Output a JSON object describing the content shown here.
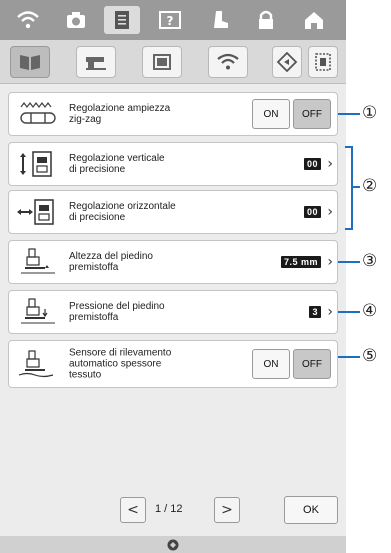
{
  "topbar": {
    "icons": [
      "wifi-icon",
      "camera-icon",
      "document-icon",
      "help-icon",
      "boot-icon",
      "lock-icon",
      "home-icon"
    ],
    "active_index": 2
  },
  "tabs": {
    "items": [
      "book-tab-icon",
      "sewing-machine-tab-icon",
      "embroidery-frame-tab-icon",
      "wifi-tab-icon"
    ],
    "selected_index": 0,
    "right_icons": [
      "diamond-icon",
      "frame-icon"
    ]
  },
  "settings": [
    {
      "label": "Regolazione ampiezza\nzig-zag",
      "on": "ON",
      "off": "OFF",
      "state": "off"
    },
    {
      "label": "Regolazione verticale\ndi precisione",
      "value": "00"
    },
    {
      "label": "Regolazione orizzontale\ndi precisione",
      "value": "00"
    },
    {
      "label": "Altezza del piedino\npremistoffa",
      "value": "7.5 mm"
    },
    {
      "label": "Pressione del piedino\npremistoffa",
      "value": "3"
    },
    {
      "label": "Sensore di rilevamento\nautomatico spessore\ntessuto",
      "on": "ON",
      "off": "OFF",
      "state": "off"
    }
  ],
  "pagination": {
    "text": "1 / 12",
    "prev": "<",
    "next": ">"
  },
  "ok_label": "OK",
  "callouts": [
    "①",
    "②",
    "③",
    "④",
    "⑤"
  ],
  "accent_color": "#1f6fbf"
}
